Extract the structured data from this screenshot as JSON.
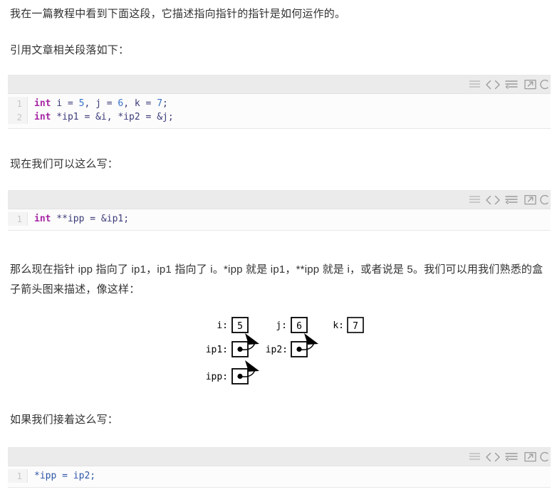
{
  "document": {
    "paragraphs": {
      "intro": "我在一篇教程中看到下面这段，它描述指向指针的指针是如何运作的。",
      "quote_lead": "引用文章相关段落如下：",
      "now_write": "现在我们可以这么写：",
      "explain": "那么现在指针 ipp 指向了 ip1，ip1 指向了 i。*ipp 就是 ip1，**ipp 就是 i，或者说是 5。我们可以用我们熟悉的盒子箭头图来描述，像这样：",
      "then_write": "如果我们接着这么写："
    }
  },
  "code_blocks": [
    {
      "id": "code-block-1",
      "language": "c",
      "line_numbers": [
        "1",
        "2"
      ],
      "lines": [
        [
          {
            "t": "int",
            "c": "kw"
          },
          {
            "t": " ",
            "c": "pln"
          },
          {
            "t": "i",
            "c": "pln"
          },
          {
            "t": " = ",
            "c": "pln"
          },
          {
            "t": "5",
            "c": "num"
          },
          {
            "t": ", ",
            "c": "pln"
          },
          {
            "t": "j",
            "c": "pln"
          },
          {
            "t": " = ",
            "c": "pln"
          },
          {
            "t": "6",
            "c": "num"
          },
          {
            "t": ", ",
            "c": "pln"
          },
          {
            "t": "k",
            "c": "pln"
          },
          {
            "t": " = ",
            "c": "pln"
          },
          {
            "t": "7",
            "c": "num"
          },
          {
            "t": ";",
            "c": "pln"
          }
        ],
        [
          {
            "t": "int",
            "c": "kw"
          },
          {
            "t": " *ip1 = &i, *ip2 = &j;",
            "c": "pln"
          }
        ]
      ],
      "toolbar": {
        "icons": [
          "list-icon",
          "code-icon",
          "word-wrap-icon",
          "external-link-icon",
          "copy-icon"
        ],
        "language_label": "c"
      }
    },
    {
      "id": "code-block-2",
      "language": "c",
      "line_numbers": [
        "1"
      ],
      "lines": [
        [
          {
            "t": "int",
            "c": "kw"
          },
          {
            "t": " **ipp = &ip1;",
            "c": "pln"
          }
        ]
      ],
      "toolbar": {
        "icons": [
          "list-icon",
          "code-icon",
          "word-wrap-icon",
          "external-link-icon",
          "copy-icon"
        ],
        "language_label": "c"
      }
    },
    {
      "id": "code-block-3",
      "language": "c",
      "line_numbers": [
        "1"
      ],
      "lines": [
        [
          {
            "t": "*ipp = ip2;",
            "c": "blue"
          }
        ]
      ],
      "toolbar": {
        "icons": [
          "list-icon",
          "code-icon",
          "word-wrap-icon",
          "external-link-icon",
          "copy-icon"
        ],
        "language_label": "c"
      }
    }
  ],
  "diagram": {
    "title": "pointer-box-arrow-diagram",
    "boxes": [
      {
        "name": "i",
        "label": "i:",
        "value": "5",
        "kind": "value"
      },
      {
        "name": "j",
        "label": "j:",
        "value": "6",
        "kind": "value"
      },
      {
        "name": "k",
        "label": "k:",
        "value": "7",
        "kind": "value"
      },
      {
        "name": "ip1",
        "label": "ip1:",
        "value": "",
        "kind": "pointer"
      },
      {
        "name": "ip2",
        "label": "ip2:",
        "value": "",
        "kind": "pointer"
      },
      {
        "name": "ipp",
        "label": "ipp:",
        "value": "",
        "kind": "pointer"
      }
    ],
    "arrows": [
      {
        "from": "ip1",
        "to": "i"
      },
      {
        "from": "ip2",
        "to": "j"
      },
      {
        "from": "ipp",
        "to": "ip1"
      }
    ]
  },
  "colors": {
    "page_background": "#ffffff",
    "text": "#333333",
    "code_toolbar_bg": "#ebebeb",
    "code_body_bg": "#fcfcfc",
    "gutter_bg": "#f4f4f4",
    "gutter_text": "#c6c6c6",
    "keyword": "#a626a4",
    "number": "#3873c8",
    "plain_code": "#3b3b7a",
    "blue_code": "#2f56a8",
    "diagram_stroke": "#000000"
  }
}
